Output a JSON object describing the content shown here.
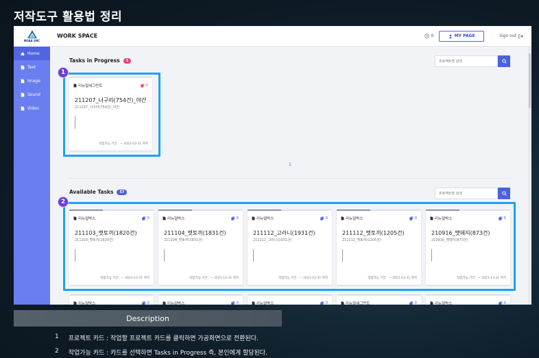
{
  "page_title": "저작도구 활용법 정리",
  "app": {
    "logo_text": "NOAA SNC",
    "sidebar": [
      {
        "label": "Home",
        "icon": "home-icon",
        "active": true
      },
      {
        "label": "Text",
        "icon": "file-icon",
        "active": false
      },
      {
        "label": "Image",
        "icon": "file-icon",
        "active": false
      },
      {
        "label": "Sound",
        "icon": "file-icon",
        "active": false
      },
      {
        "label": "Video",
        "icon": "file-icon",
        "active": false
      }
    ],
    "topbar": {
      "title": "WORK SPACE",
      "notif_count": "0",
      "mypage_label": "MY PAGE",
      "signout_label": "Sign out"
    },
    "in_progress": {
      "title": "Tasks in Progress",
      "count": "1",
      "search_placeholder": "프로젝트명 검색",
      "page": "1",
      "cards": [
        {
          "type": "리뉴얼세그먼트",
          "count": "0",
          "name": "211207_너구리(754건)_야간",
          "sub": "211207_너구리(754건)_야간",
          "deadline": "작업가능 기간 : ~ 2022-03-31 까지"
        }
      ]
    },
    "available": {
      "title": "Available Tasks",
      "count": "57",
      "search_placeholder": "프로젝트명 검색",
      "cards": [
        {
          "type": "리뉴얼박스",
          "count": "0",
          "name": "211103_멧토끼(1820건)",
          "sub": "211103_멧토끼(1820건)",
          "deadline": "작업가능 기간 : ~ 2021-12-31 까지"
        },
        {
          "type": "리뉴얼박스",
          "count": "0",
          "name": "211104_멧토끼(1831건)",
          "sub": "211104_멧토끼(1831건)",
          "deadline": "작업가능 기간 : ~ 2021-12-31 까지"
        },
        {
          "type": "리뉴얼박스",
          "count": "0",
          "name": "211112_고라니(1931건)",
          "sub": "211112_고라니(1931건)",
          "deadline": "작업가능 기간 : ~ 2021-12-31 까지"
        },
        {
          "type": "리뉴얼박스",
          "count": "0",
          "name": "211112_멧토끼(1205건)",
          "sub": "211112_멧토끼(1205건)",
          "deadline": "작업가능 기간 : ~ 2021-12-31 까지"
        },
        {
          "type": "리뉴얼박스",
          "count": "0",
          "name": "210916_멧돼지(873건)",
          "sub": "210916_멧돼지(873건)",
          "deadline": "작업가능 기간 : ~ 2021-12-31 까지"
        }
      ],
      "next_row": [
        {
          "type": "리뉴얼박스",
          "count": "0"
        },
        {
          "type": "리뉴얼박스",
          "count": "0"
        },
        {
          "type": "리뉴얼박스",
          "count": "0"
        },
        {
          "type": "리뉴얼세그먼트",
          "count": "0"
        },
        {
          "type": "리뉴얼박스",
          "count": "0"
        }
      ]
    }
  },
  "markers": [
    "1",
    "2"
  ],
  "description": {
    "title": "Description",
    "items": [
      {
        "num": "1",
        "text": "프로젝트 카드 : 작업할 프로젝트 카드를 클릭하면 가공화면으로 전환된다."
      },
      {
        "num": "2",
        "text": "작업가능 카드 : 카드를 선택하면 Tasks in Progress 측, 본인에게 할당된다."
      }
    ]
  },
  "colors": {
    "accent": "#4b61dd",
    "sidebar": "#6a7ef0",
    "highlight": "#1aa3f0",
    "marker": "#6b3fd6",
    "badge_pink": "#e8457c"
  }
}
